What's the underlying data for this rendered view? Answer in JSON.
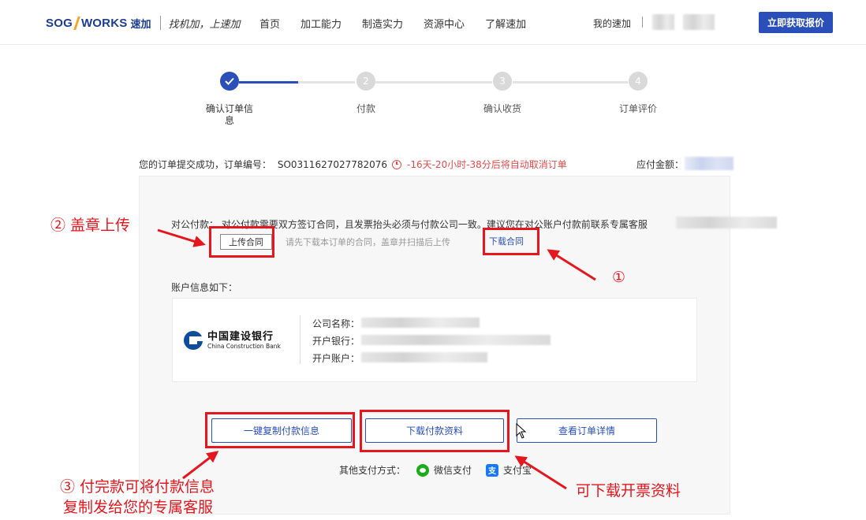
{
  "header": {
    "logo": {
      "word_left": "SOG",
      "word_right": "WORKS",
      "cn": "速加",
      "slogan": "找机加，上速加"
    },
    "nav": [
      "首页",
      "加工能力",
      "制造实力",
      "资源中心",
      "了解速加"
    ],
    "my_account": "我的速加",
    "quote_button": "立即获取报价"
  },
  "steps": [
    {
      "num": "",
      "label": "确认订单信息",
      "state": "done"
    },
    {
      "num": "2",
      "label": "付款",
      "state": "todo"
    },
    {
      "num": "3",
      "label": "确认收货",
      "state": "todo"
    },
    {
      "num": "4",
      "label": "订单评价",
      "state": "todo"
    }
  ],
  "order": {
    "text": "您的订单提交成功，订单编号：",
    "number": "SO0311627027782076",
    "countdown": "-16天-20小时-38分后将自动取消订单",
    "amount_label": "应付金额："
  },
  "corporate": {
    "text": "对公付款：  对公付款需要双方签订合同，且发票抬头必须与付款公司一致。建议您在对公账户付款前联系专属客服",
    "upload_button": "上传合同",
    "upload_hint": "请先下载本订单的合同，盖章并扫描后上传",
    "download_link": "下载合同"
  },
  "account": {
    "title": "账户信息如下：",
    "bank_cn": "中国建设银行",
    "bank_en": "China Construction Bank",
    "fields": [
      "公司名称：",
      "开户银行：",
      "开户账户："
    ]
  },
  "actions": {
    "copy": "一键复制付款信息",
    "download": "下载付款资料",
    "view": "查看订单详情"
  },
  "other_pay": {
    "label": "其他支付方式：",
    "wechat": "微信支付",
    "alipay": "支付宝"
  },
  "annotations": {
    "stamp_upload": "② 盖章上传",
    "step1": "①",
    "copy_note_1": "③ 付完款可将付款信息",
    "copy_note_2": "复制发给您的专属客服",
    "invoice_note": "可下载开票资料"
  },
  "colors": {
    "brand": "#2a4fb9",
    "accent": "#f5a623",
    "annotation": "#e5161d",
    "countdown": "#e84a4a"
  }
}
